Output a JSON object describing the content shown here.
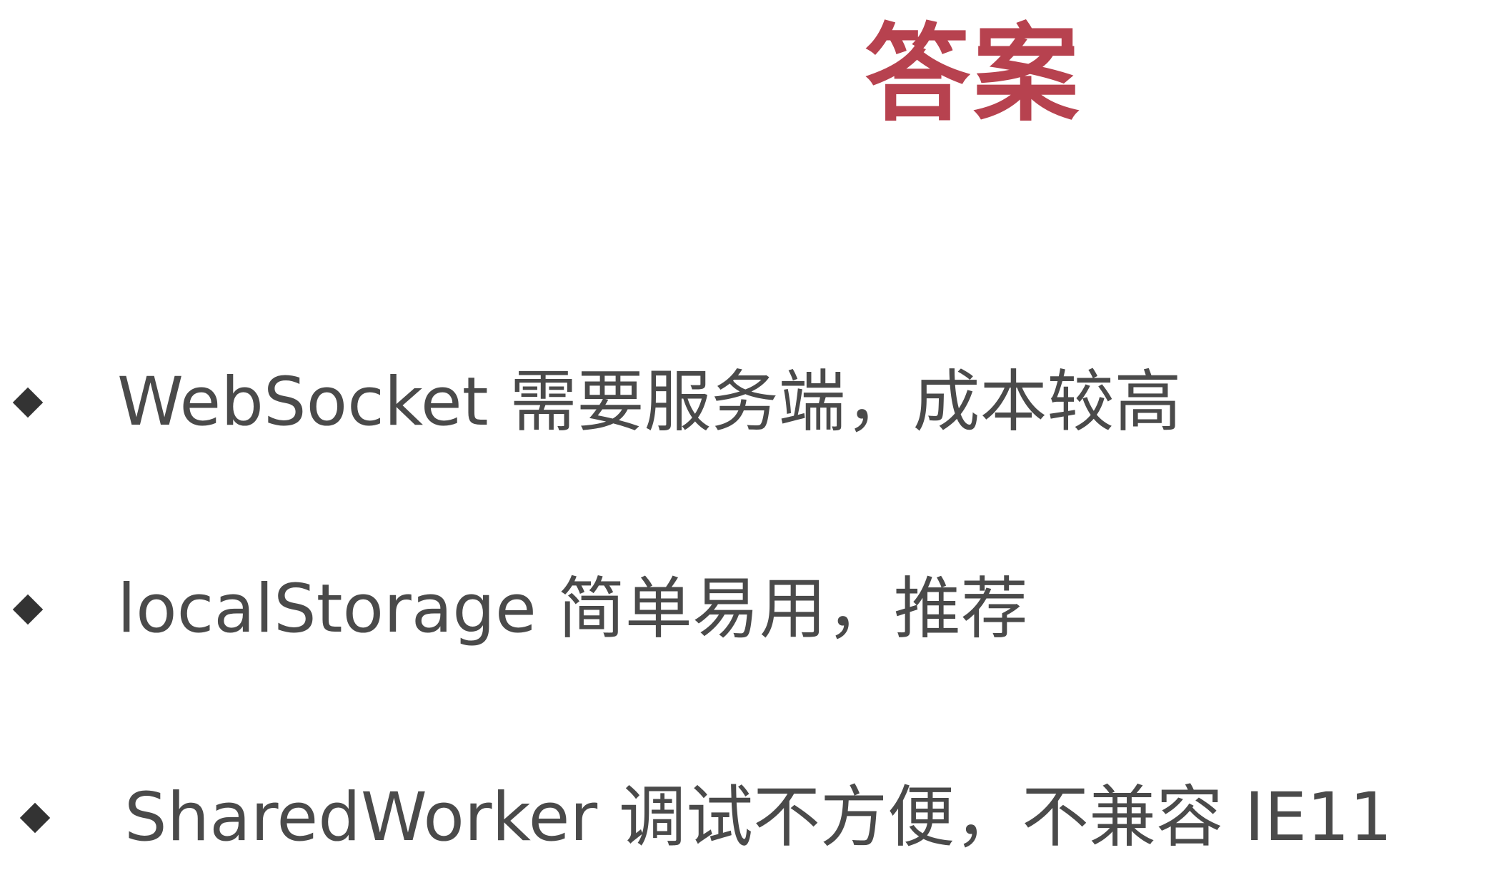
{
  "slide": {
    "title": "答案",
    "bullets": [
      {
        "icon": "diamond-bullet-icon",
        "text": "WebSocket 需要服务端，成本较高"
      },
      {
        "icon": "diamond-bullet-icon",
        "text": "localStorage 简单易用，推荐"
      },
      {
        "icon": "diamond-bullet-icon",
        "text": "SharedWorker 调试不方便，不兼容 IE11"
      }
    ]
  },
  "colors": {
    "title": "#b7424f",
    "bullet_text": "#4a4a4a",
    "bullet_marker": "#333333",
    "background": "#ffffff"
  }
}
